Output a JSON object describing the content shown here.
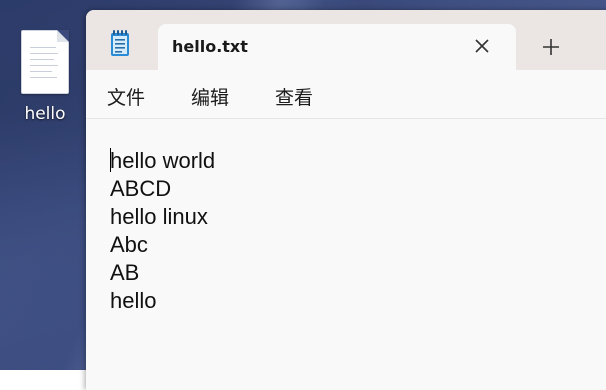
{
  "desktop": {
    "icon_label": "hello",
    "icon_name": "text-file-icon"
  },
  "window": {
    "app_icon": "notepad-icon",
    "tab": {
      "title": "hello.txt",
      "close_icon": "close-icon"
    },
    "new_tab_icon": "plus-icon",
    "menu": {
      "file": "文件",
      "edit": "编辑",
      "view": "查看"
    },
    "editor": {
      "lines": [
        "hello world",
        "ABCD",
        "hello linux",
        "Abc",
        "AB",
        "hello"
      ]
    }
  },
  "colors": {
    "titlebar": "#ebe6e3",
    "editor_bg": "#f9f9f9",
    "text": "#111111"
  }
}
